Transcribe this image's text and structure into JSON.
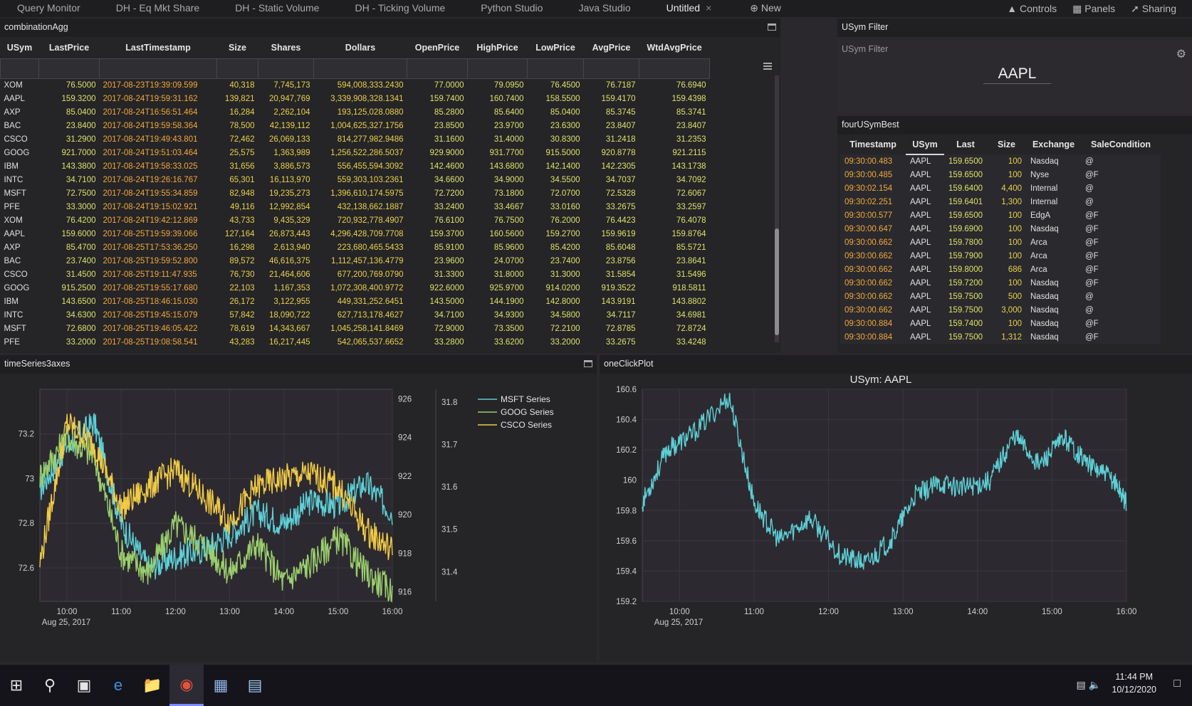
{
  "tabs": [
    {
      "label": "Query Monitor"
    },
    {
      "label": "DH - Eq Mkt Share"
    },
    {
      "label": "DH - Static Volume"
    },
    {
      "label": "DH - Ticking Volume"
    },
    {
      "label": "Python Studio"
    },
    {
      "label": "Java Studio"
    },
    {
      "label": "Untitled",
      "active": true
    }
  ],
  "new_tab_label": "New",
  "toolbar": {
    "controls": "Controls",
    "panels": "Panels",
    "sharing": "Sharing"
  },
  "combination": {
    "title": "combinationAgg",
    "columns": [
      "USym",
      "LastPrice",
      "LastTimestamp",
      "Size",
      "Shares",
      "Dollars",
      "OpenPrice",
      "HighPrice",
      "LowPrice",
      "AvgPrice",
      "WtdAvgPrice"
    ],
    "rows": [
      [
        "XOM",
        "76.5000",
        "2017-08-23T19:39:09.599",
        "40,318",
        "7,745,173",
        "594,008,333.2430",
        "77.0000",
        "79.0950",
        "76.4500",
        "76.7187",
        "76.6940"
      ],
      [
        "AAPL",
        "159.3200",
        "2017-08-24T19:59:31.162",
        "139,821",
        "20,947,769",
        "3,339,908,328.1341",
        "159.7400",
        "160.7400",
        "158.5500",
        "159.4170",
        "159.4398"
      ],
      [
        "AXP",
        "85.0400",
        "2017-08-24T16:56:51.464",
        "16,284",
        "2,262,104",
        "193,125,028.0880",
        "85.2800",
        "85.6400",
        "85.0400",
        "85.3745",
        "85.3741"
      ],
      [
        "BAC",
        "23.8400",
        "2017-08-24T19:59:58.364",
        "78,500",
        "42,139,112",
        "1,004,625,327.1756",
        "23.8500",
        "23.9700",
        "23.6300",
        "23.8407",
        "23.8407"
      ],
      [
        "CSCO",
        "31.2900",
        "2017-08-24T19:49:43.801",
        "72,462",
        "26,069,133",
        "814,277,982.9486",
        "31.1600",
        "31.4000",
        "30.8300",
        "31.2418",
        "31.2353"
      ],
      [
        "GOOG",
        "921.7000",
        "2017-08-24T19:51:03.464",
        "25,575",
        "1,363,989",
        "1,256,522,286.5037",
        "929.9000",
        "931.7700",
        "915.5000",
        "920.8778",
        "921.2115"
      ],
      [
        "IBM",
        "143.3800",
        "2017-08-24T19:58:33.025",
        "31,656",
        "3,886,573",
        "556,455,594.3092",
        "142.4600",
        "143.6800",
        "142.1400",
        "142.2305",
        "143.1738"
      ],
      [
        "INTC",
        "34.7100",
        "2017-08-24T19:26:16.767",
        "65,301",
        "16,113,970",
        "559,303,103.2361",
        "34.6600",
        "34.9000",
        "34.5500",
        "34.7037",
        "34.7092"
      ],
      [
        "MSFT",
        "72.7500",
        "2017-08-24T19:55:34.859",
        "82,948",
        "19,235,273",
        "1,396,610,174.5975",
        "72.7200",
        "73.1800",
        "72.0700",
        "72.5328",
        "72.6067"
      ],
      [
        "PFE",
        "33.3000",
        "2017-08-24T19:15:02.921",
        "49,116",
        "12,992,854",
        "432,138,662.1887",
        "33.2400",
        "33.4667",
        "33.0160",
        "33.2675",
        "33.2597"
      ],
      [
        "XOM",
        "76.4200",
        "2017-08-24T19:42:12.869",
        "43,733",
        "9,435,329",
        "720,932,778.4907",
        "76.6100",
        "76.7500",
        "76.2000",
        "76.4423",
        "76.4078"
      ],
      [
        "AAPL",
        "159.6000",
        "2017-08-25T19:59:39.066",
        "127,164",
        "26,873,443",
        "4,296,428,709.7708",
        "159.3700",
        "160.5600",
        "159.2700",
        "159.9619",
        "159.8764"
      ],
      [
        "AXP",
        "85.4700",
        "2017-08-25T17:53:36.250",
        "16,298",
        "2,613,940",
        "223,680,465.5433",
        "85.9100",
        "85.9600",
        "85.4200",
        "85.6048",
        "85.5721"
      ],
      [
        "BAC",
        "23.7400",
        "2017-08-25T19:59:52.800",
        "89,572",
        "46,616,375",
        "1,112,457,136.4779",
        "23.9600",
        "24.0700",
        "23.7400",
        "23.8756",
        "23.8641"
      ],
      [
        "CSCO",
        "31.4500",
        "2017-08-25T19:11:47.935",
        "76,730",
        "21,464,606",
        "677,200,769.0790",
        "31.3300",
        "31.8000",
        "31.3000",
        "31.5854",
        "31.5496"
      ],
      [
        "GOOG",
        "915.2500",
        "2017-08-25T19:55:17.680",
        "22,103",
        "1,167,353",
        "1,072,308,400.9772",
        "922.6000",
        "925.9700",
        "914.0200",
        "919.3522",
        "918.5811"
      ],
      [
        "IBM",
        "143.6500",
        "2017-08-25T18:46:15.030",
        "26,172",
        "3,122,955",
        "449,331,252.6451",
        "143.5000",
        "144.1900",
        "142.8000",
        "143.9191",
        "143.8802"
      ],
      [
        "INTC",
        "34.6300",
        "2017-08-25T19:45:15.079",
        "57,842",
        "18,090,722",
        "627,713,178.4627",
        "34.7100",
        "34.9300",
        "34.5800",
        "34.7117",
        "34.6981"
      ],
      [
        "MSFT",
        "72.6800",
        "2017-08-25T19:46:05.422",
        "78,619",
        "14,343,667",
        "1,045,258,141.8469",
        "72.9000",
        "73.3500",
        "72.2100",
        "72.8785",
        "72.8724"
      ],
      [
        "PFE",
        "33.2000",
        "2017-08-25T19:08:58.541",
        "43,283",
        "16,217,445",
        "542,065,537.6652",
        "33.2800",
        "33.6200",
        "33.2000",
        "33.2675",
        "33.4248"
      ]
    ]
  },
  "usym_filter": {
    "title": "USym Filter",
    "label": "USym Filter",
    "value": "AAPL"
  },
  "best": {
    "title": "fourUSymBest",
    "columns": [
      "Timestamp",
      "USym",
      "Last",
      "Size",
      "Exchange",
      "SaleCondition"
    ],
    "rows": [
      [
        "09:30:00.483",
        "AAPL",
        "159.6500",
        "100",
        "Nasdaq",
        "@"
      ],
      [
        "09:30:00.485",
        "AAPL",
        "159.6500",
        "100",
        "Nyse",
        "@F"
      ],
      [
        "09:30:02.154",
        "AAPL",
        "159.6400",
        "4,400",
        "Internal",
        "@"
      ],
      [
        "09:30:02.251",
        "AAPL",
        "159.6401",
        "1,300",
        "Internal",
        "@"
      ],
      [
        "09:30:00.577",
        "AAPL",
        "159.6500",
        "100",
        "EdgA",
        "@F"
      ],
      [
        "09:30:00.647",
        "AAPL",
        "159.6900",
        "100",
        "Nasdaq",
        "@F"
      ],
      [
        "09:30:00.662",
        "AAPL",
        "159.7800",
        "100",
        "Arca",
        "@F"
      ],
      [
        "09:30:00.662",
        "AAPL",
        "159.7900",
        "100",
        "Arca",
        "@F"
      ],
      [
        "09:30:00.662",
        "AAPL",
        "159.8000",
        "686",
        "Arca",
        "@F"
      ],
      [
        "09:30:00.662",
        "AAPL",
        "159.7200",
        "100",
        "Nasdaq",
        "@F"
      ],
      [
        "09:30:00.662",
        "AAPL",
        "159.7500",
        "500",
        "Nasdaq",
        "@"
      ],
      [
        "09:30:00.662",
        "AAPL",
        "159.7500",
        "3,000",
        "Nasdaq",
        "@"
      ],
      [
        "09:30:00.884",
        "AAPL",
        "159.7400",
        "100",
        "Nasdaq",
        "@F"
      ],
      [
        "09:30:00.884",
        "AAPL",
        "159.7500",
        "1,312",
        "Nasdaq",
        "@F"
      ]
    ]
  },
  "chart_data": [
    {
      "panel_title": "timeSeries3axes",
      "type": "line",
      "x_ticks": [
        "10:00",
        "11:00",
        "12:00",
        "13:00",
        "14:00",
        "15:00",
        "16:00"
      ],
      "date_label": "Aug 25, 2017",
      "y_left_ticks": [
        "73.2",
        "73",
        "72.8",
        "72.6"
      ],
      "y_mid_ticks": [
        "926",
        "924",
        "922",
        "920",
        "918",
        "916"
      ],
      "y_right_ticks": [
        "31.8",
        "31.7",
        "31.6",
        "31.5",
        "31.4"
      ],
      "ylim_left": [
        72.45,
        73.4
      ],
      "ylim_mid": [
        915.5,
        926.5
      ],
      "ylim_right": [
        31.33,
        31.83
      ],
      "legend_position": "top-right",
      "series": [
        {
          "name": "MSFT Series",
          "color": "#5ed0d6",
          "axis": "left",
          "x": [
            "09:30",
            "10:00",
            "10:30",
            "11:00",
            "11:30",
            "12:00",
            "12:30",
            "13:00",
            "13:30",
            "14:00",
            "14:30",
            "15:00",
            "15:30",
            "16:00"
          ],
          "values": [
            72.95,
            73.15,
            73.25,
            72.8,
            72.6,
            72.65,
            72.68,
            72.75,
            72.85,
            72.8,
            72.9,
            72.88,
            72.98,
            72.85
          ]
        },
        {
          "name": "GOOG Series",
          "color": "#9ccf6e",
          "axis": "mid",
          "x": [
            "09:30",
            "10:00",
            "10:30",
            "11:00",
            "11:30",
            "12:00",
            "12:30",
            "13:00",
            "13:30",
            "14:00",
            "14:30",
            "15:00",
            "15:30",
            "16:00"
          ],
          "values": [
            922,
            924,
            923,
            918,
            917,
            919.5,
            918.5,
            917,
            918.5,
            916.5,
            917.5,
            918.8,
            917,
            916
          ]
        },
        {
          "name": "CSCO Series",
          "color": "#f2cb46",
          "axis": "right",
          "x": [
            "09:30",
            "10:00",
            "10:30",
            "11:00",
            "11:30",
            "12:00",
            "12:30",
            "13:00",
            "13:30",
            "14:00",
            "14:30",
            "15:00",
            "15:30",
            "16:00"
          ],
          "values": [
            31.42,
            31.75,
            31.7,
            31.55,
            31.6,
            31.64,
            31.58,
            31.52,
            31.6,
            31.62,
            31.63,
            31.6,
            31.5,
            31.45
          ]
        }
      ]
    },
    {
      "panel_title": "oneClickPlot",
      "type": "line",
      "title": "USym: AAPL",
      "x_ticks": [
        "10:00",
        "11:00",
        "12:00",
        "13:00",
        "14:00",
        "15:00",
        "16:00"
      ],
      "date_label": "Aug 25, 2017",
      "y_ticks": [
        "160.6",
        "160.4",
        "160.2",
        "160",
        "159.8",
        "159.6",
        "159.4",
        "159.2"
      ],
      "ylim": [
        159.2,
        160.6
      ],
      "series": [
        {
          "color": "#5ed0d6",
          "x": [
            "09:30",
            "09:50",
            "10:10",
            "10:40",
            "11:00",
            "11:20",
            "11:45",
            "12:10",
            "12:30",
            "12:50",
            "13:10",
            "13:30",
            "13:50",
            "14:10",
            "14:30",
            "14:50",
            "15:10",
            "15:30",
            "15:50",
            "16:00"
          ],
          "values": [
            159.85,
            160.2,
            160.3,
            160.55,
            159.85,
            159.6,
            159.75,
            159.5,
            159.45,
            159.6,
            159.9,
            159.98,
            159.95,
            160.0,
            160.3,
            160.1,
            160.28,
            160.1,
            160.0,
            159.85
          ]
        }
      ]
    }
  ],
  "taskbar": {
    "time": "11:44 PM",
    "date": "10/12/2020"
  }
}
